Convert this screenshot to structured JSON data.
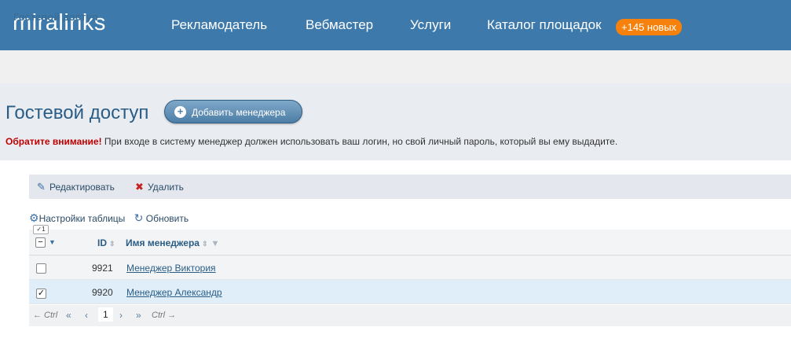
{
  "header": {
    "logo": "miralinks",
    "nav": [
      "Рекламодатель",
      "Вебмастер",
      "Услуги",
      "Каталог площадок"
    ],
    "badge": "+145 новых",
    "bg": "#3d7aab",
    "badge_color": "#f6820d"
  },
  "breadcrumb": "Гостевой доступ",
  "page": {
    "title": "Гостевой доступ",
    "add_button": "Добавить менеджера",
    "notice_warn": "Обратите внимание!",
    "notice_text": " При входе в систему менеджер должен использовать ваш логин, но свой личный пароль, который вы ему выдадите."
  },
  "toolbar": {
    "edit": "Редактировать",
    "delete": "Удалить",
    "settings": "Настройки таблицы",
    "refresh": "Обновить",
    "selected_count": "✓1"
  },
  "table": {
    "columns": [
      "ID",
      "Имя менеджера"
    ],
    "rows": [
      {
        "id": "9921",
        "name": "Менеджер Виктория",
        "checked": false
      },
      {
        "id": "9920",
        "name": "Менеджер Александр",
        "checked": true
      }
    ]
  },
  "pager": {
    "prev_hint": "← Ctrl",
    "first": "«",
    "prev": "‹",
    "page": "1",
    "next": "›",
    "last": "»",
    "next_hint": "Ctrl →"
  }
}
